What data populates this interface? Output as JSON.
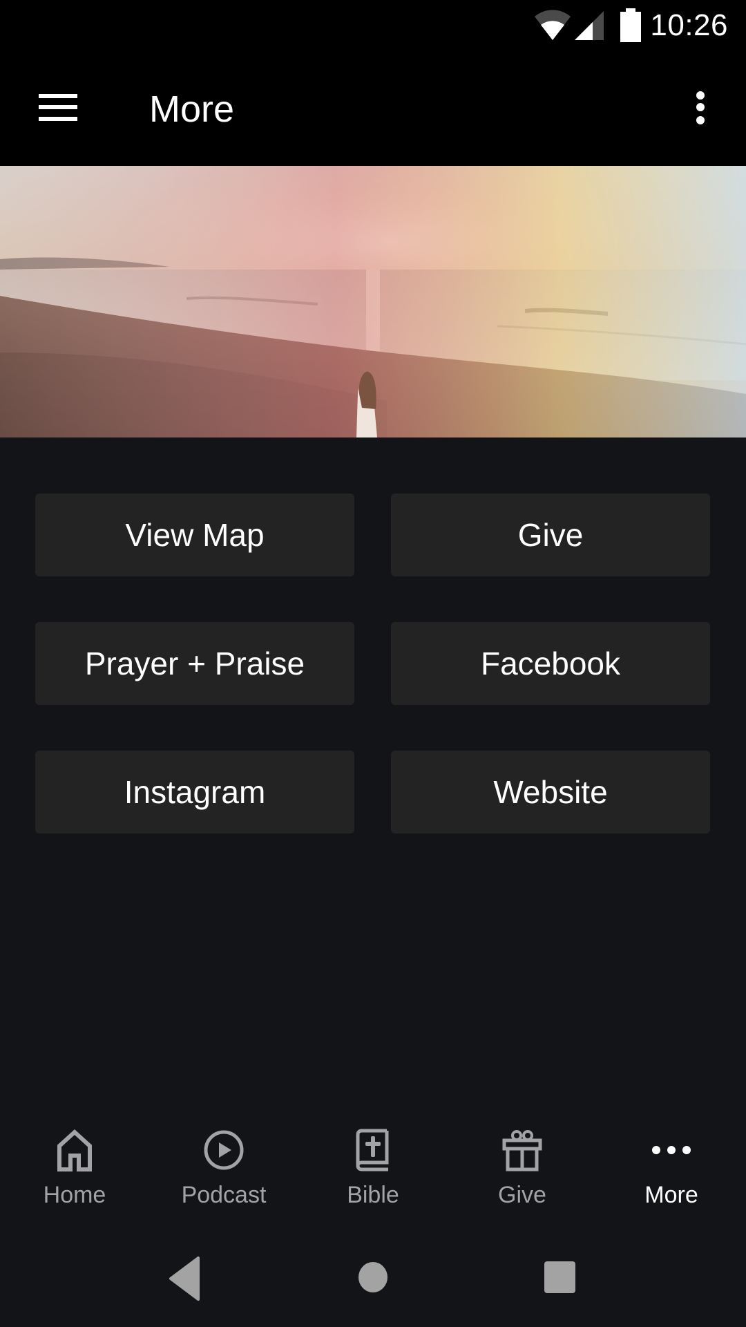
{
  "status_bar": {
    "time": "10:26",
    "icons": [
      "wifi-icon",
      "cellular-signal-icon",
      "battery-icon"
    ]
  },
  "toolbar": {
    "menu_icon": "hamburger-menu-icon",
    "title": "More",
    "overflow_icon": "more-vert-icon"
  },
  "hero": {
    "description": "Sunset over ocean beach with a woman standing on a grassy dune"
  },
  "buttons": [
    {
      "label": "View Map"
    },
    {
      "label": "Give"
    },
    {
      "label": "Prayer + Praise"
    },
    {
      "label": "Facebook"
    },
    {
      "label": "Instagram"
    },
    {
      "label": "Website"
    }
  ],
  "bottom_nav": {
    "items": [
      {
        "label": "Home",
        "icon": "home-icon",
        "active": false
      },
      {
        "label": "Podcast",
        "icon": "play-circle-icon",
        "active": false
      },
      {
        "label": "Bible",
        "icon": "bible-icon",
        "active": false
      },
      {
        "label": "Give",
        "icon": "gift-icon",
        "active": false
      },
      {
        "label": "More",
        "icon": "more-horiz-icon",
        "active": true
      }
    ]
  },
  "system_nav": {
    "back": "back-icon",
    "home": "home-circle-icon",
    "recents": "recents-icon"
  },
  "colors": {
    "background": "#131417",
    "toolbar": "#000000",
    "button": "#232324",
    "nav_inactive": "#a3a3a5",
    "nav_active": "#ffffff"
  }
}
